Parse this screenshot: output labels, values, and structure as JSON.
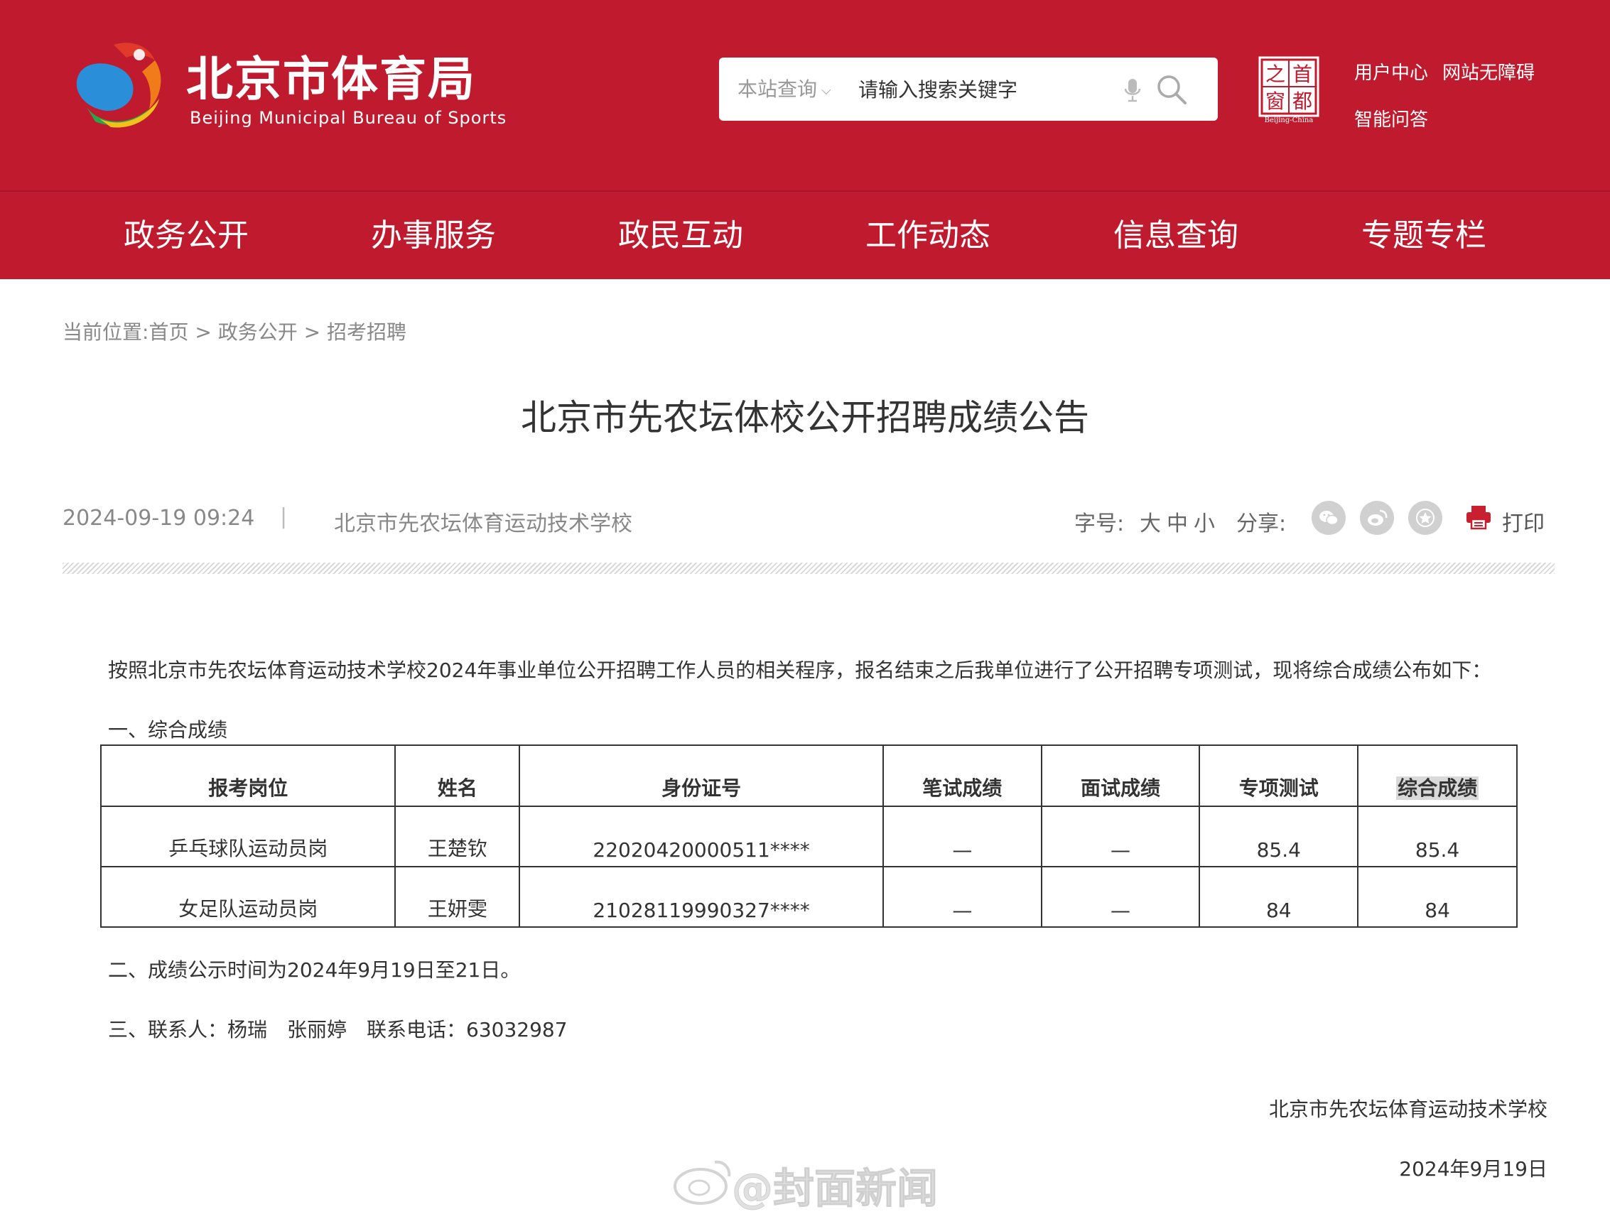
{
  "header": {
    "logo_title": "北京市体育局",
    "logo_subtitle": "Beijing Municipal Bureau of Sports",
    "search": {
      "scope_label": "本站查询",
      "placeholder": "请输入搜索关键字"
    },
    "seal": {
      "chars": [
        "之",
        "首",
        "窗",
        "都"
      ],
      "caption": "Beijing-China"
    },
    "links": {
      "user_center": "用户中心",
      "accessibility": "网站无障碍",
      "smart_qa": "智能问答"
    }
  },
  "nav": {
    "items": [
      "政务公开",
      "办事服务",
      "政民互动",
      "工作动态",
      "信息查询",
      "专题专栏"
    ]
  },
  "breadcrumb": {
    "prefix": "当前位置:",
    "items": [
      "首页",
      "政务公开",
      "招考招聘"
    ],
    "separator": ">"
  },
  "article": {
    "title": "北京市先农坛体校公开招聘成绩公告",
    "date": "2024-09-19 09:24",
    "divider": "|",
    "source": "北京市先农坛体育运动技术学校",
    "font_size_label": "字号:",
    "font_sizes": [
      "大",
      "中",
      "小"
    ],
    "share_label": "分享:",
    "share_icons": [
      "wechat-icon",
      "weibo-icon",
      "favorite-icon"
    ],
    "print_label": "打印",
    "intro": "按照北京市先农坛体育运动技术学校2024年事业单位公开招聘工作人员的相关程序，报名结束之后我单位进行了公开招聘专项测试，现将综合成绩公布如下：",
    "section1": "一、综合成绩",
    "table": {
      "headers": [
        "报考岗位",
        "姓名",
        "身份证号",
        "笔试成绩",
        "面试成绩",
        "专项测试",
        "综合成绩"
      ],
      "rows": [
        [
          "乒乓球队运动员岗",
          "王楚钦",
          "22020420000511****",
          "—",
          "—",
          "85.4",
          "85.4"
        ],
        [
          "女足队运动员岗",
          "王妍雯",
          "21028119990327****",
          "—",
          "—",
          "84",
          "84"
        ]
      ]
    },
    "section2": "二、成绩公示时间为2024年9月19日至21日。",
    "section3": "三、联系人：杨瑞　张丽婷　联系电话：63032987",
    "sign_org": "北京市先农坛体育运动技术学校",
    "sign_date": "2024年9月19日"
  },
  "watermark": "@封面新闻",
  "colors": {
    "brand_red": "#c01a2e",
    "text": "#333333",
    "muted": "#888888"
  }
}
